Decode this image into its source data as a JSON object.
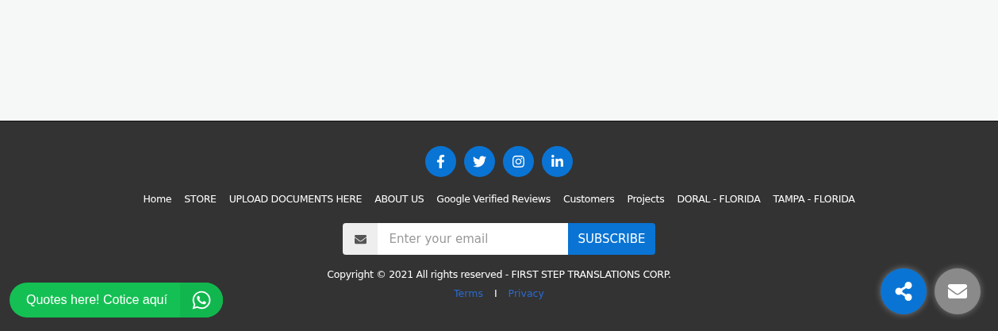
{
  "social": [
    {
      "kind": "facebook"
    },
    {
      "kind": "twitter"
    },
    {
      "kind": "instagram"
    },
    {
      "kind": "linkedin"
    }
  ],
  "nav": [
    "Home",
    "STORE",
    "UPLOAD DOCUMENTS HERE",
    "ABOUT US",
    "Google Verified Reviews",
    "Customers",
    "Projects",
    "DORAL - FLORIDA",
    "TAMPA - FLORIDA"
  ],
  "subscribe": {
    "placeholder": "Enter your email",
    "button": "SUBSCRIBE"
  },
  "copyright": "Copyright © 2021 All rights reserved - FIRST STEP TRANSLATIONS CORP.",
  "legal": {
    "links": [
      "Terms",
      "Privacy"
    ],
    "separator": "I"
  },
  "whatsapp": {
    "label": "Quotes here! Cotice aquí"
  }
}
